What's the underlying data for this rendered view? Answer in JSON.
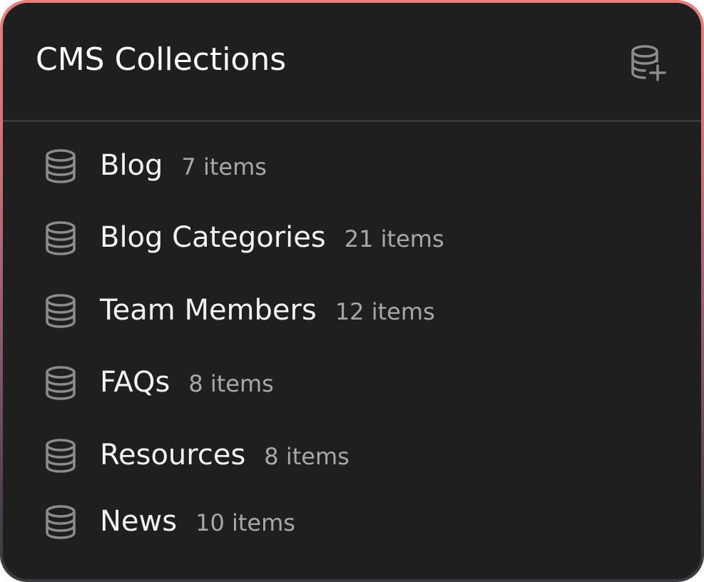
{
  "header": {
    "title": "CMS Collections",
    "add_icon": "database-plus-icon"
  },
  "collections": [
    {
      "name": "Blog",
      "count": "7 items",
      "icon": "database-icon"
    },
    {
      "name": "Blog Categories",
      "count": "21 items",
      "icon": "database-icon"
    },
    {
      "name": "Team Members",
      "count": "12 items",
      "icon": "database-icon"
    },
    {
      "name": "FAQs",
      "count": "8 items",
      "icon": "database-icon"
    },
    {
      "name": "Resources",
      "count": "8 items",
      "icon": "database-icon"
    },
    {
      "name": "News",
      "count": "10 items",
      "icon": "database-icon"
    }
  ],
  "colors": {
    "panel_background": "#1f1f1f",
    "border_gradient_top": "#e9807c",
    "border_gradient_bottom": "#3a3a3e",
    "name_text": "#f2f2f2",
    "count_text": "#a8a8a8",
    "icon": "#8c8c8c"
  }
}
